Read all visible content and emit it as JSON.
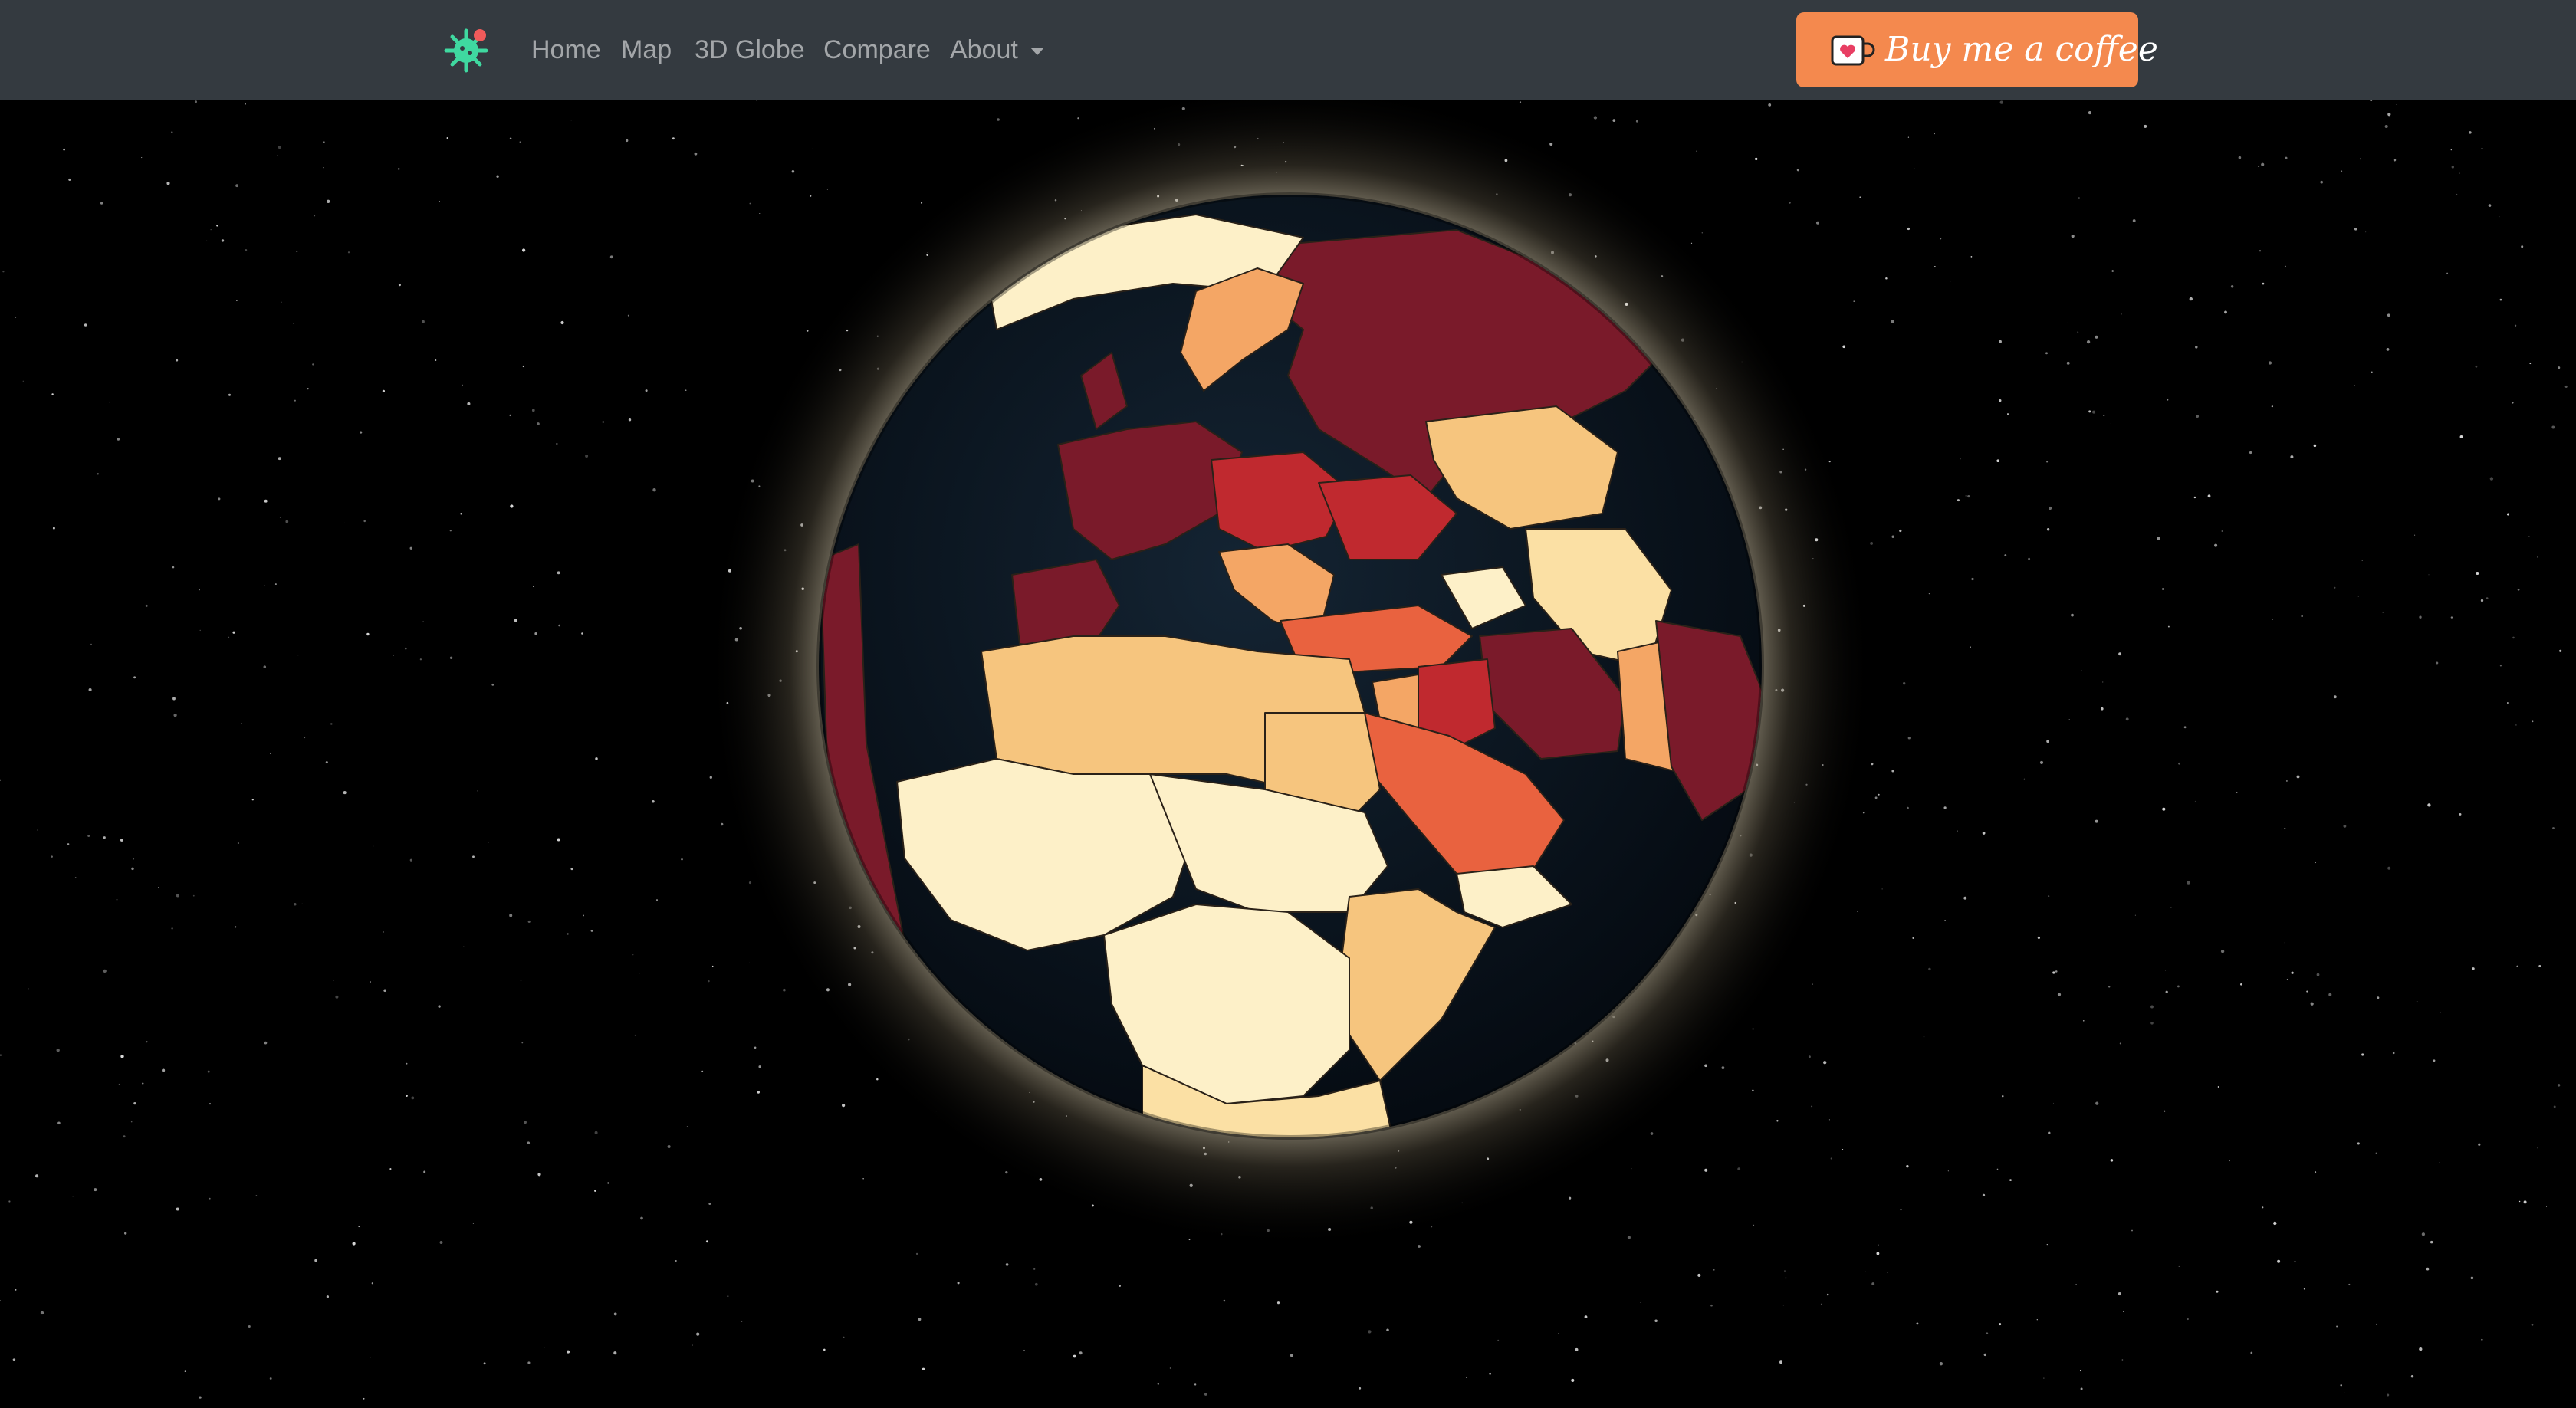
{
  "navbar": {
    "brand_icon": "virus-icon",
    "links": [
      {
        "label": "Home"
      },
      {
        "label": "Map"
      },
      {
        "label": "3D Globe"
      },
      {
        "label": "Compare"
      },
      {
        "label": "About"
      }
    ],
    "coffee_button": {
      "label": "Buy me a coffee",
      "icon": "coffee-cup-heart-icon",
      "color": "#f4894e"
    }
  },
  "globe": {
    "view": "Europe, Africa, Middle East",
    "colors": {
      "background": "#000000",
      "navbar": "#343a40",
      "ocean": "#0b1620",
      "palette": [
        "#fdf0c8",
        "#fbe0a4",
        "#f6c57e",
        "#f4a665",
        "#e9623f",
        "#c0292f",
        "#7a1a2a"
      ]
    }
  }
}
